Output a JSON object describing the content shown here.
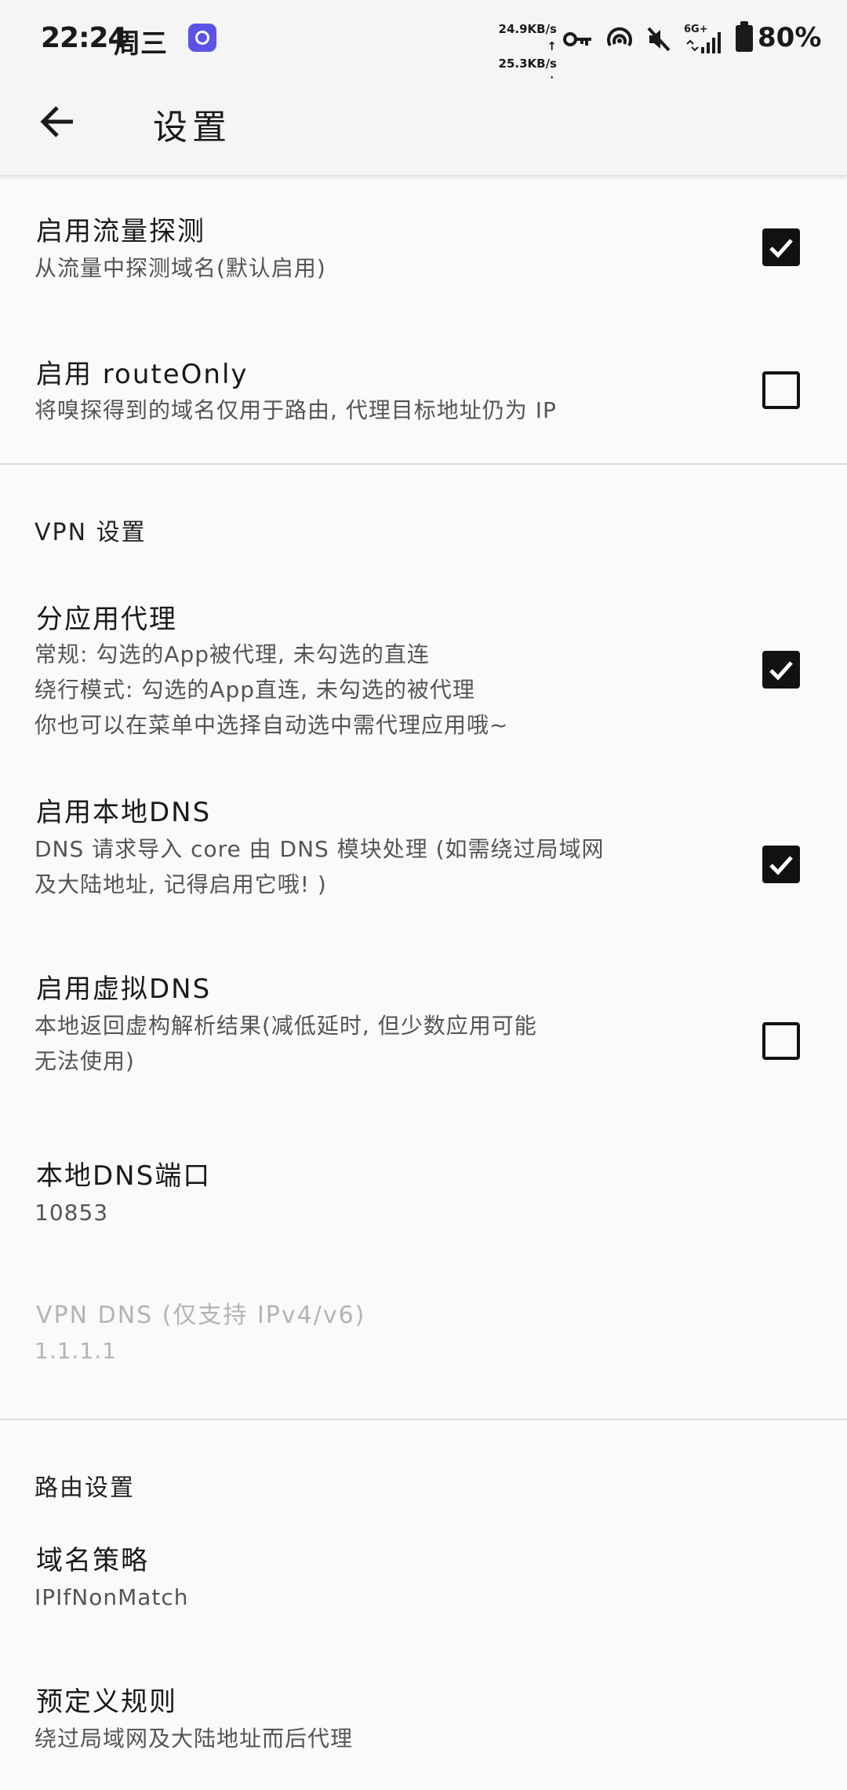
{
  "status_bar": {
    "time": "22:24",
    "day": "周三",
    "speed_up": "24.9KB/s ↑",
    "speed_down": "25.3KB/s ↓",
    "network": "6G+",
    "battery": "80%",
    "icons": [
      "app-icon",
      "vpn-key-icon",
      "hotspot-icon",
      "mute-icon",
      "signal-icon",
      "battery-icon"
    ]
  },
  "app_bar": {
    "back_icon": "arrow-left-icon",
    "title": "设置"
  },
  "prefs": {
    "sniffing": {
      "title": "启用流量探测",
      "summary": "从流量中探测域名(默认启用)",
      "checked": true
    },
    "route_only": {
      "title": "启用 routeOnly",
      "summary": "将嗅探得到的域名仅用于路由, 代理目标地址仍为 IP",
      "checked": false
    },
    "vpn_section": "VPN 设置",
    "per_app": {
      "title": "分应用代理",
      "summary_lines": [
        "常规: 勾选的App被代理, 未勾选的直连",
        "绕行模式: 勾选的App直连, 未勾选的被代理",
        "你也可以在菜单中选择自动选中需代理应用哦~"
      ],
      "checked": true
    },
    "local_dns": {
      "title": "启用本地DNS",
      "summary_lines": [
        "DNS 请求导入 core 由 DNS 模块处理 (如需绕过局域网",
        "及大陆地址, 记得启用它哦! )"
      ],
      "checked": true
    },
    "fake_dns": {
      "title": "启用虚拟DNS",
      "summary_lines": [
        "本地返回虚构解析结果(减低延时, 但少数应用可能",
        "无法使用)"
      ],
      "checked": false
    },
    "local_dns_port": {
      "title": "本地DNS端口",
      "value": "10853"
    },
    "vpn_dns": {
      "title": "VPN DNS (仅支持 IPv4/v6)",
      "value": "1.1.1.1"
    },
    "routing_section": "路由设置",
    "domain_strategy": {
      "title": "域名策略",
      "value": "IPIfNonMatch"
    },
    "predefined_rules": {
      "title": "预定义规则",
      "value": "绕过局域网及大陆地址而后代理"
    }
  },
  "colors": {
    "background": "#fafafa",
    "appbar": "#f5f5f5",
    "checkbox": "#111111",
    "disabled_text": "#b4b4b4"
  }
}
